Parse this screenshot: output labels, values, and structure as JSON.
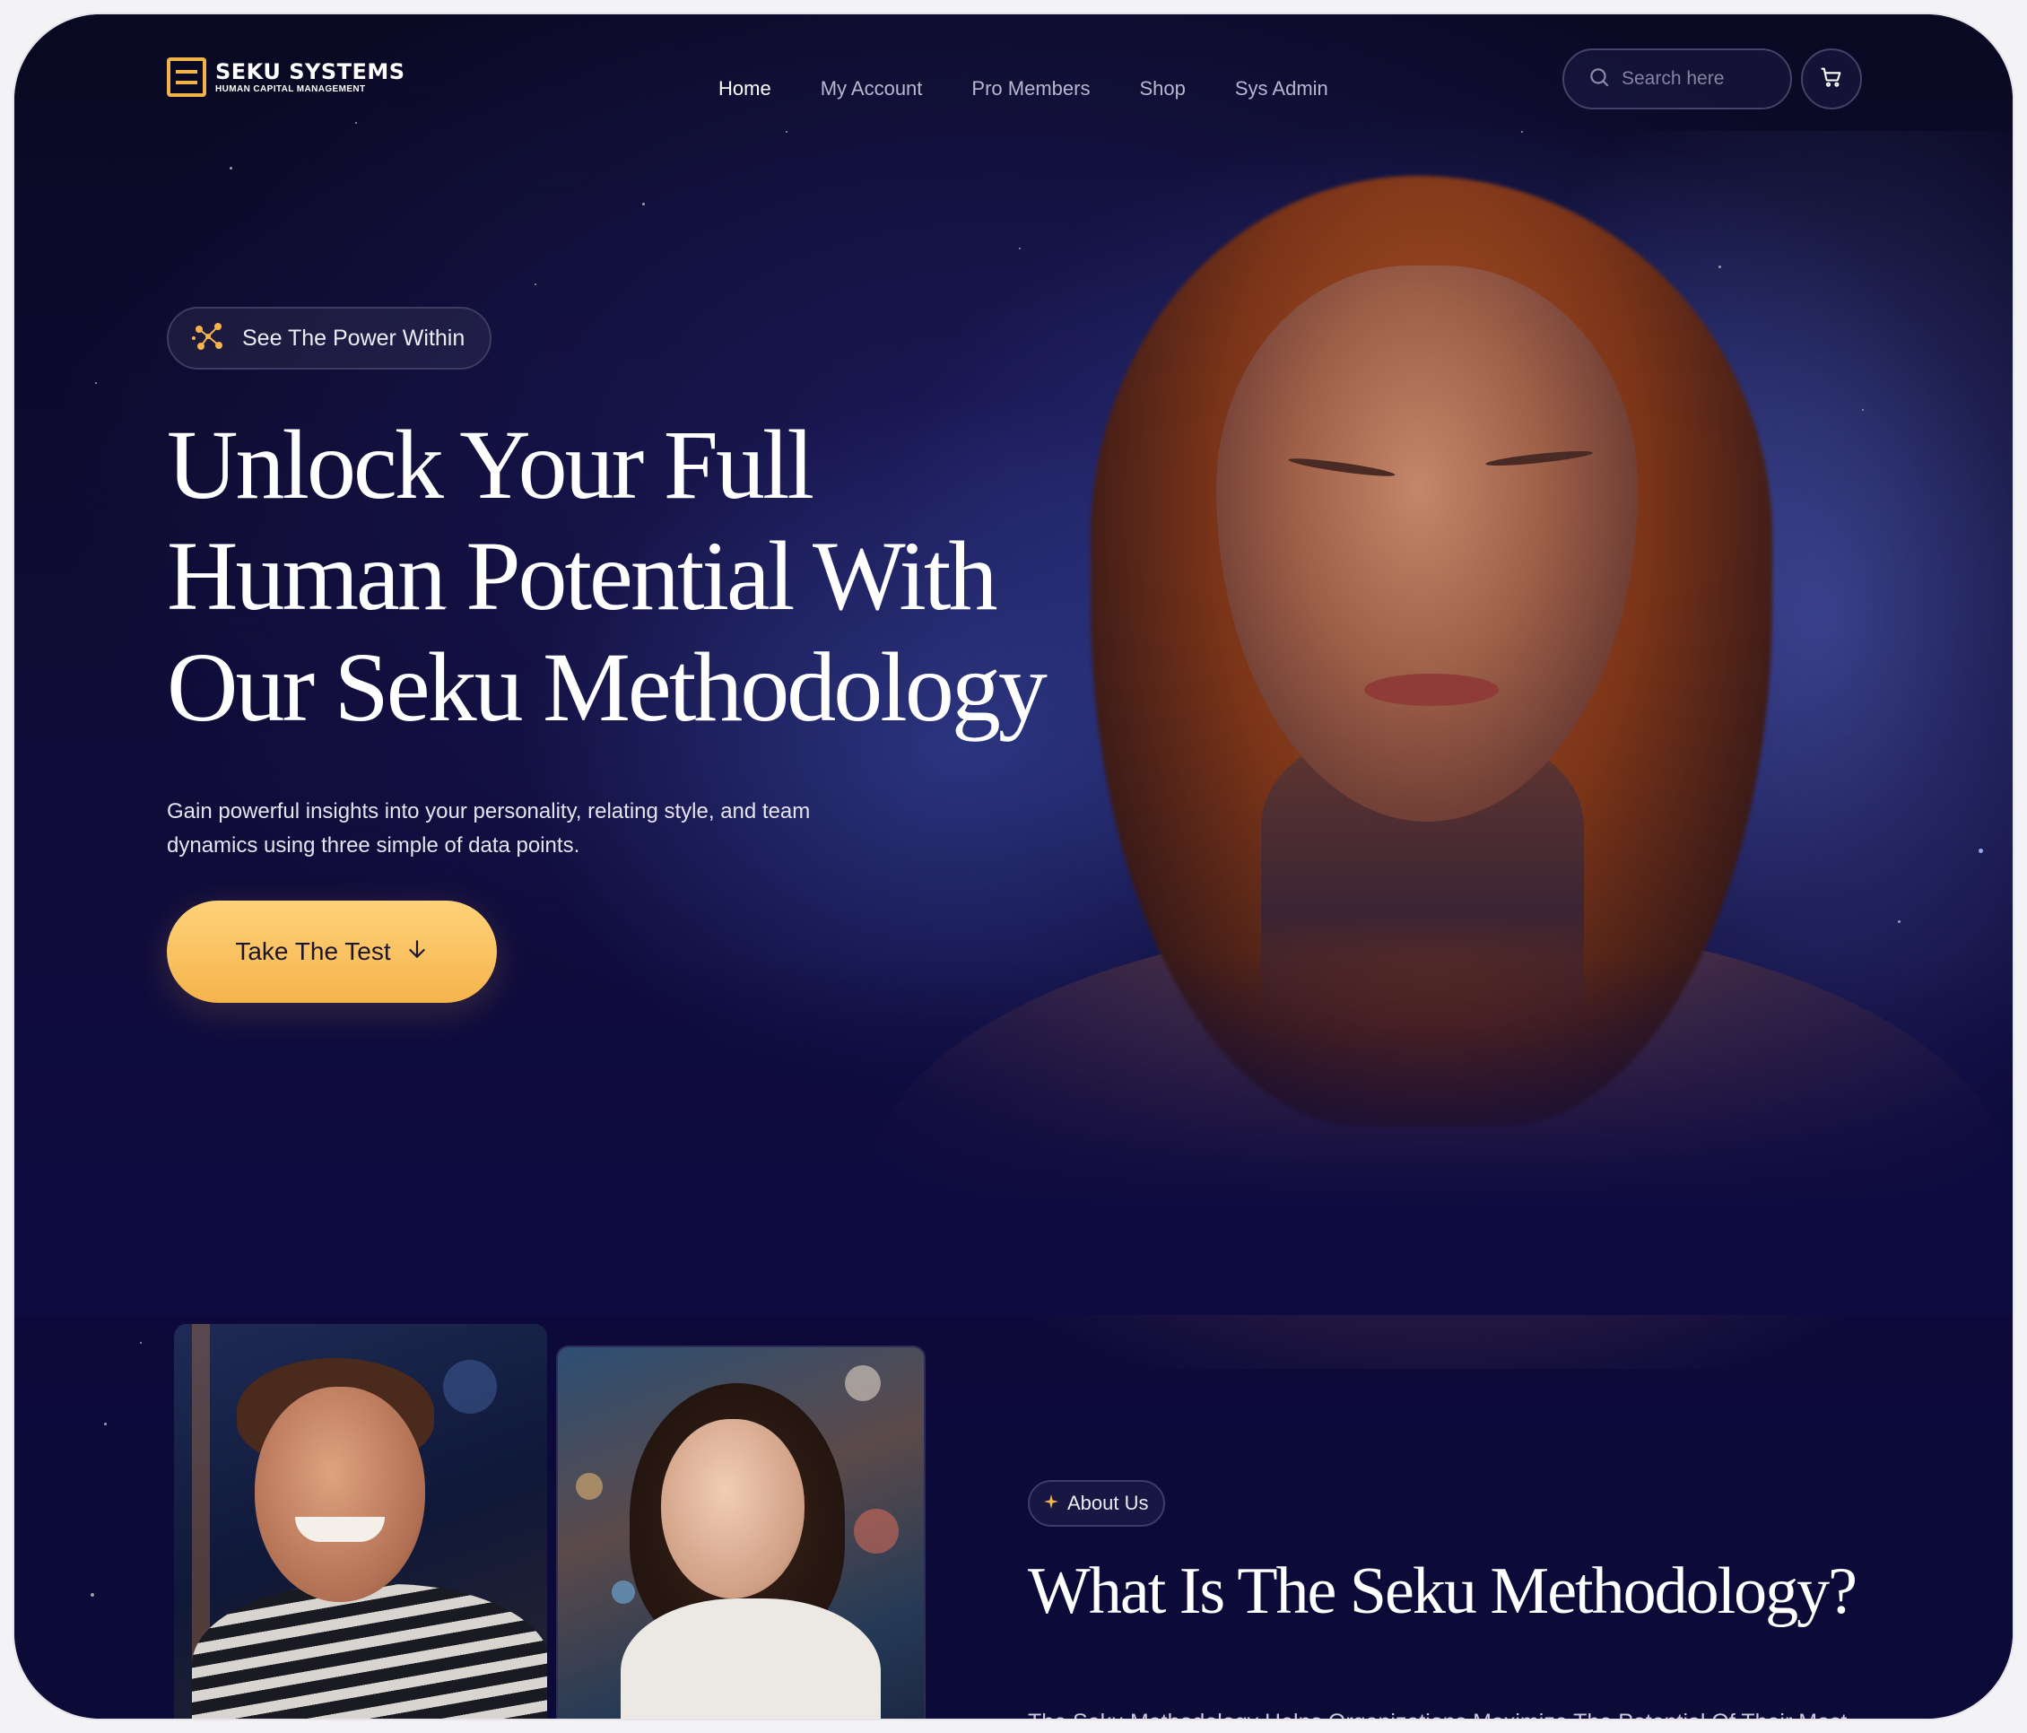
{
  "brand": {
    "name": "SEKU SYSTEMS",
    "tagline": "Human Capital Management"
  },
  "nav": {
    "items": [
      {
        "label": "Home",
        "active": true
      },
      {
        "label": "My Account",
        "active": false
      },
      {
        "label": "Pro Members",
        "active": false
      },
      {
        "label": "Shop",
        "active": false
      },
      {
        "label": "Sys Admin",
        "active": false
      }
    ]
  },
  "search": {
    "placeholder": "Search here",
    "value": ""
  },
  "cart": {
    "icon": "cart-icon"
  },
  "hero": {
    "pill_label": "See The Power Within",
    "pill_icon": "constellation-icon",
    "title_lines": [
      "Unlock Your Full",
      "Human Potential With",
      "Our Seku Methodology"
    ],
    "subtitle": "Gain powerful insights into your personality, relating style, and team dynamics using three simple of data points.",
    "cta_label": "Take The Test",
    "cta_icon": "arrow-down-icon"
  },
  "about": {
    "pill_label": "About Us",
    "pill_icon": "sparkle-icon",
    "title": "What Is The Seku Methodology?",
    "body": "The Seku Methodology Helps Organizations Maximize The Potential Of Their Most"
  },
  "colors": {
    "accent": "#f5b44c",
    "background": "#0c0a2e",
    "text": "#ffffff",
    "muted": "#b9b6cf"
  }
}
